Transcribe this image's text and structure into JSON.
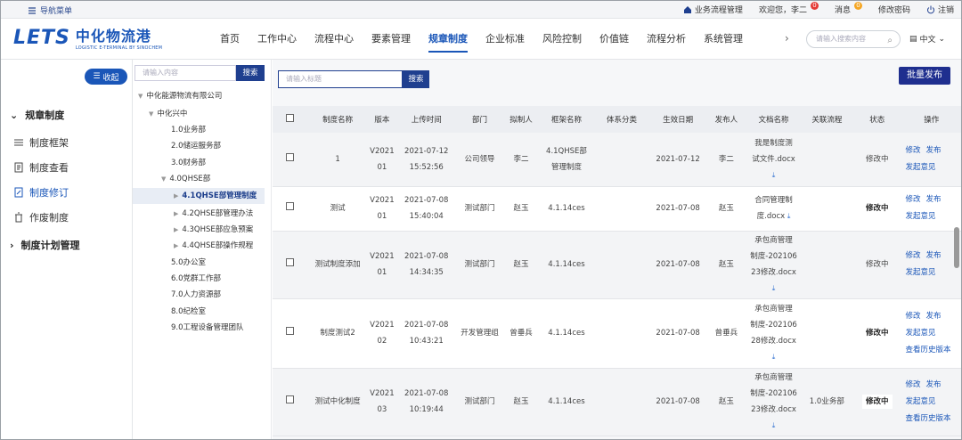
{
  "topbar": {
    "nav_menu": "导航菜单",
    "biz_mgmt": "业务流程管理",
    "welcome": "欢迎您，李二",
    "welcome_badge": "0",
    "messages": "消息",
    "messages_badge": "0",
    "change_pwd": "修改密码",
    "logout": "注销"
  },
  "header": {
    "logo_en": "LETS",
    "logo_cn": "中化物流港",
    "logo_sub": "LOGISTIC E-TERMINAL BY SINOCHEM",
    "nav": [
      "首页",
      "工作中心",
      "流程中心",
      "要素管理",
      "规章制度",
      "企业标准",
      "风险控制",
      "价值链",
      "流程分析",
      "系统管理"
    ],
    "active_nav": "规章制度",
    "search_placeholder": "请输入搜索内容",
    "language": "中文",
    "more_arrow": "›"
  },
  "sidebar": {
    "collapse": "收起",
    "group1": "规章制度",
    "items": [
      "制度框架",
      "制度查看",
      "制度修订",
      "作废制度"
    ],
    "active_item": "制度修订",
    "group2": "制度计划管理"
  },
  "tree": {
    "search_placeholder": "请输入内容",
    "search_btn": "搜索",
    "nodes": [
      "中化能源物流有限公司",
      "中化兴中",
      "1.0业务部",
      "2.0储运服务部",
      "3.0财务部",
      "4.0QHSE部",
      "4.1QHSE部管理制度",
      "4.2QHSE部管理办法",
      "4.3QHSE部应急预案",
      "4.4QHSE部操作规程",
      "5.0办公室",
      "6.0党群工作部",
      "7.0人力资源部",
      "8.0纪检室",
      "9.0工程设备管理团队"
    ]
  },
  "main": {
    "search_placeholder": "请输入标题",
    "search_btn": "搜索",
    "batch_btn": "批量发布",
    "columns": [
      "",
      "制度名称",
      "版本",
      "上传时间",
      "部门",
      "拟制人",
      "框架名称",
      "体系分类",
      "生效日期",
      "发布人",
      "文档名称",
      "关联流程",
      "状态",
      "操作"
    ],
    "rows": [
      {
        "name": "1",
        "version": [
          "V2021",
          "01"
        ],
        "time": [
          "2021-07-12",
          "15:52:56"
        ],
        "dept": "公司领导",
        "author": "李二",
        "framework": [
          "4.1QHSE部",
          "管理制度"
        ],
        "system": "",
        "effective": "2021-07-12",
        "publisher": "李二",
        "doc": [
          "我是制度测",
          "试文件.docx"
        ],
        "process": "",
        "status": "修改中",
        "ops": [
          "修改",
          "发布",
          "发起意见"
        ]
      },
      {
        "name": "测试",
        "version": [
          "V2021",
          "01"
        ],
        "time": [
          "2021-07-08",
          "15:40:04"
        ],
        "dept": "测试部门",
        "author": "赵玉",
        "framework": [
          "4.1.14ces"
        ],
        "system": "",
        "effective": "2021-07-08",
        "publisher": "赵玉",
        "doc": [
          "合同管理制",
          "度.docx"
        ],
        "process": "",
        "status": "修改中",
        "ops": [
          "修改",
          "发布",
          "发起意见"
        ]
      },
      {
        "name": "测试制度添加",
        "version": [
          "V2021",
          "01"
        ],
        "time": [
          "2021-07-08",
          "14:34:35"
        ],
        "dept": "测试部门",
        "author": "赵玉",
        "framework": [
          "4.1.14ces"
        ],
        "system": "",
        "effective": "2021-07-08",
        "publisher": "赵玉",
        "doc": [
          "承包商管理",
          "制度-202106",
          "23修改.docx"
        ],
        "process": "",
        "status": "修改中",
        "ops": [
          "修改",
          "发布",
          "发起意见"
        ]
      },
      {
        "name": "制度测试2",
        "version": [
          "V2021",
          "02"
        ],
        "time": [
          "2021-07-08",
          "10:43:21"
        ],
        "dept": "开发管理组",
        "author": "曾垂兵",
        "framework": [
          "4.1.14ces"
        ],
        "system": "",
        "effective": "2021-07-08",
        "publisher": "曾垂兵",
        "doc": [
          "承包商管理",
          "制度-202106",
          "28修改.docx"
        ],
        "process": "",
        "status": "修改中",
        "ops": [
          "修改",
          "发布",
          "发起意见",
          "查看历史版本"
        ]
      },
      {
        "name": "测试中化制度",
        "version": [
          "V2021",
          "03"
        ],
        "time": [
          "2021-07-08",
          "10:19:44"
        ],
        "dept": "测试部门",
        "author": "赵玉",
        "framework": [
          "4.1.14ces"
        ],
        "system": "",
        "effective": "2021-07-08",
        "publisher": "赵玉",
        "doc": [
          "承包商管理",
          "制度-202106",
          "23修改.docx"
        ],
        "process": "1.0业务部",
        "status": "修改中",
        "ops": [
          "修改",
          "发布",
          "发起意见",
          "查看历史版本"
        ]
      }
    ]
  }
}
